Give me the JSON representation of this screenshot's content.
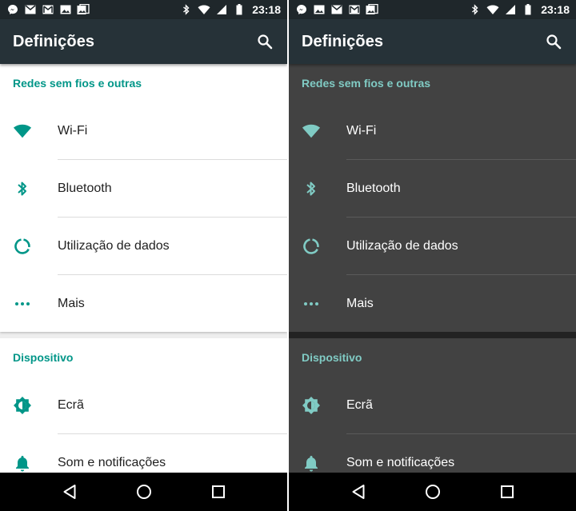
{
  "status_bar": {
    "time": "23:18"
  },
  "app_bar": {
    "title": "Definições",
    "search_icon": "search-icon"
  },
  "sections": {
    "wireless": {
      "header": "Redes sem fios e outras",
      "items": [
        {
          "label": "Wi-Fi",
          "icon": "wifi-icon"
        },
        {
          "label": "Bluetooth",
          "icon": "bluetooth-icon"
        },
        {
          "label": "Utilização de dados",
          "icon": "data-usage-icon"
        },
        {
          "label": "Mais",
          "icon": "more-horiz-icon"
        }
      ]
    },
    "device": {
      "header": "Dispositivo",
      "items": [
        {
          "label": "Ecrã",
          "icon": "brightness-icon"
        },
        {
          "label": "Som e notificações",
          "icon": "bell-icon"
        }
      ]
    }
  },
  "themes": {
    "light": {
      "accent": "#009688",
      "background": "#ffffff",
      "text": "#212121"
    },
    "dark": {
      "accent": "#80cbc4",
      "background": "#424242",
      "text": "#ffffff"
    }
  },
  "nav_bar": {
    "back_icon": "back-triangle-icon",
    "home_icon": "home-circle-icon",
    "recents_icon": "recents-square-icon"
  }
}
